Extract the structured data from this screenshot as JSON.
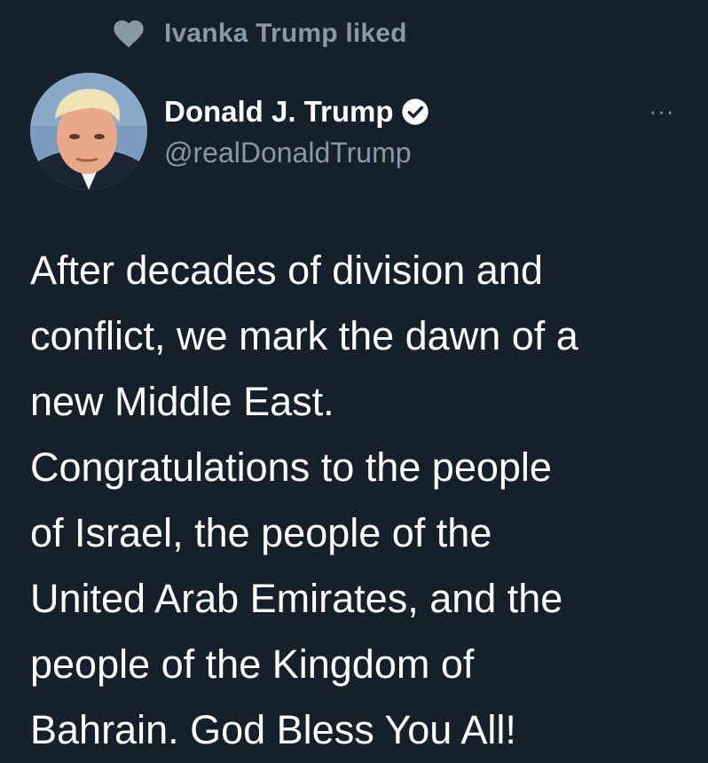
{
  "social_context": {
    "icon": "heart-icon",
    "text": "Ivanka Trump liked"
  },
  "author": {
    "name": "Donald J. Trump",
    "handle": "@realDonaldTrump",
    "verified_icon": "verified-badge-icon"
  },
  "more_menu": {
    "label": "···"
  },
  "tweet": {
    "lines": [
      "After decades of division and",
      "conflict, we mark the dawn of a",
      "new Middle East.",
      "Congratulations to the people",
      "of Israel, the people of the",
      "United Arab Emirates, and the",
      "people of the Kingdom of",
      "Bahrain. God Bless You All!"
    ]
  },
  "colors": {
    "background": "#15202b",
    "primary_text": "#ffffff",
    "secondary_text": "#8899a6",
    "heart": "#8899a6"
  }
}
